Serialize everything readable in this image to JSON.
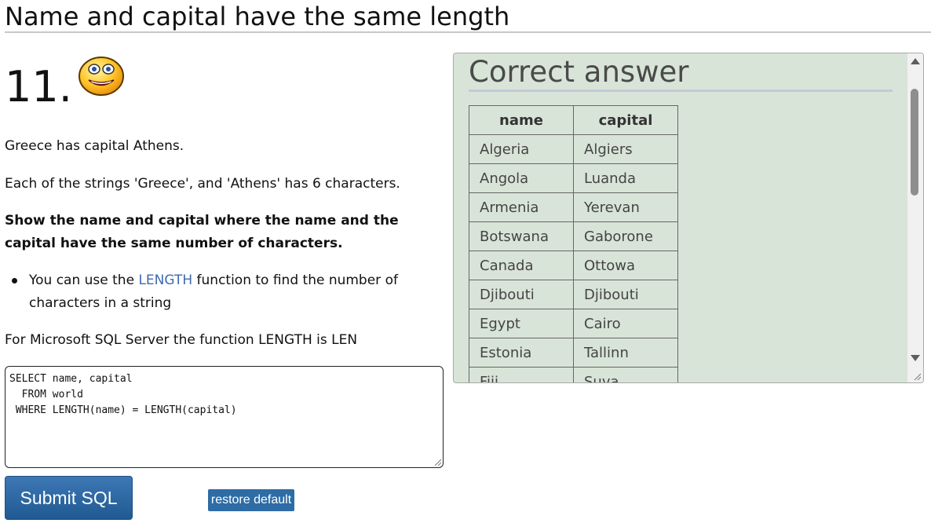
{
  "page_title": "Name and capital have the same length",
  "question": {
    "number": "11.",
    "status_icon": "smiley-face-icon",
    "intro": "Greece has capital Athens.",
    "detail": "Each of the strings 'Greece', and 'Athens' has 6 characters.",
    "task": "Show the name and capital where the name and the capital have the same number of characters.",
    "hint_before_link": "You can use the ",
    "hint_link": "LENGTH",
    "hint_after_link": " function to find the number of characters in a string",
    "mssql_note": "For Microsoft SQL Server the function LENGTH is LEN"
  },
  "editor": {
    "sql": "SELECT name, capital\n  FROM world\n WHERE LENGTH(name) = LENGTH(capital)"
  },
  "buttons": {
    "submit_label": "Submit SQL",
    "restore_label": "restore default"
  },
  "answer": {
    "title": "Correct answer",
    "columns": [
      "name",
      "capital"
    ],
    "rows": [
      [
        "Algeria",
        "Algiers"
      ],
      [
        "Angola",
        "Luanda"
      ],
      [
        "Armenia",
        "Yerevan"
      ],
      [
        "Botswana",
        "Gaborone"
      ],
      [
        "Canada",
        "Ottowa"
      ],
      [
        "Djibouti",
        "Djibouti"
      ],
      [
        "Egypt",
        "Cairo"
      ],
      [
        "Estonia",
        "Tallinn"
      ],
      [
        "Fiji",
        "Suva"
      ]
    ]
  },
  "colors": {
    "panel_background": "#d9e4d8",
    "button_blue": "#2e6ca5",
    "link_blue": "#3d6ab3"
  }
}
